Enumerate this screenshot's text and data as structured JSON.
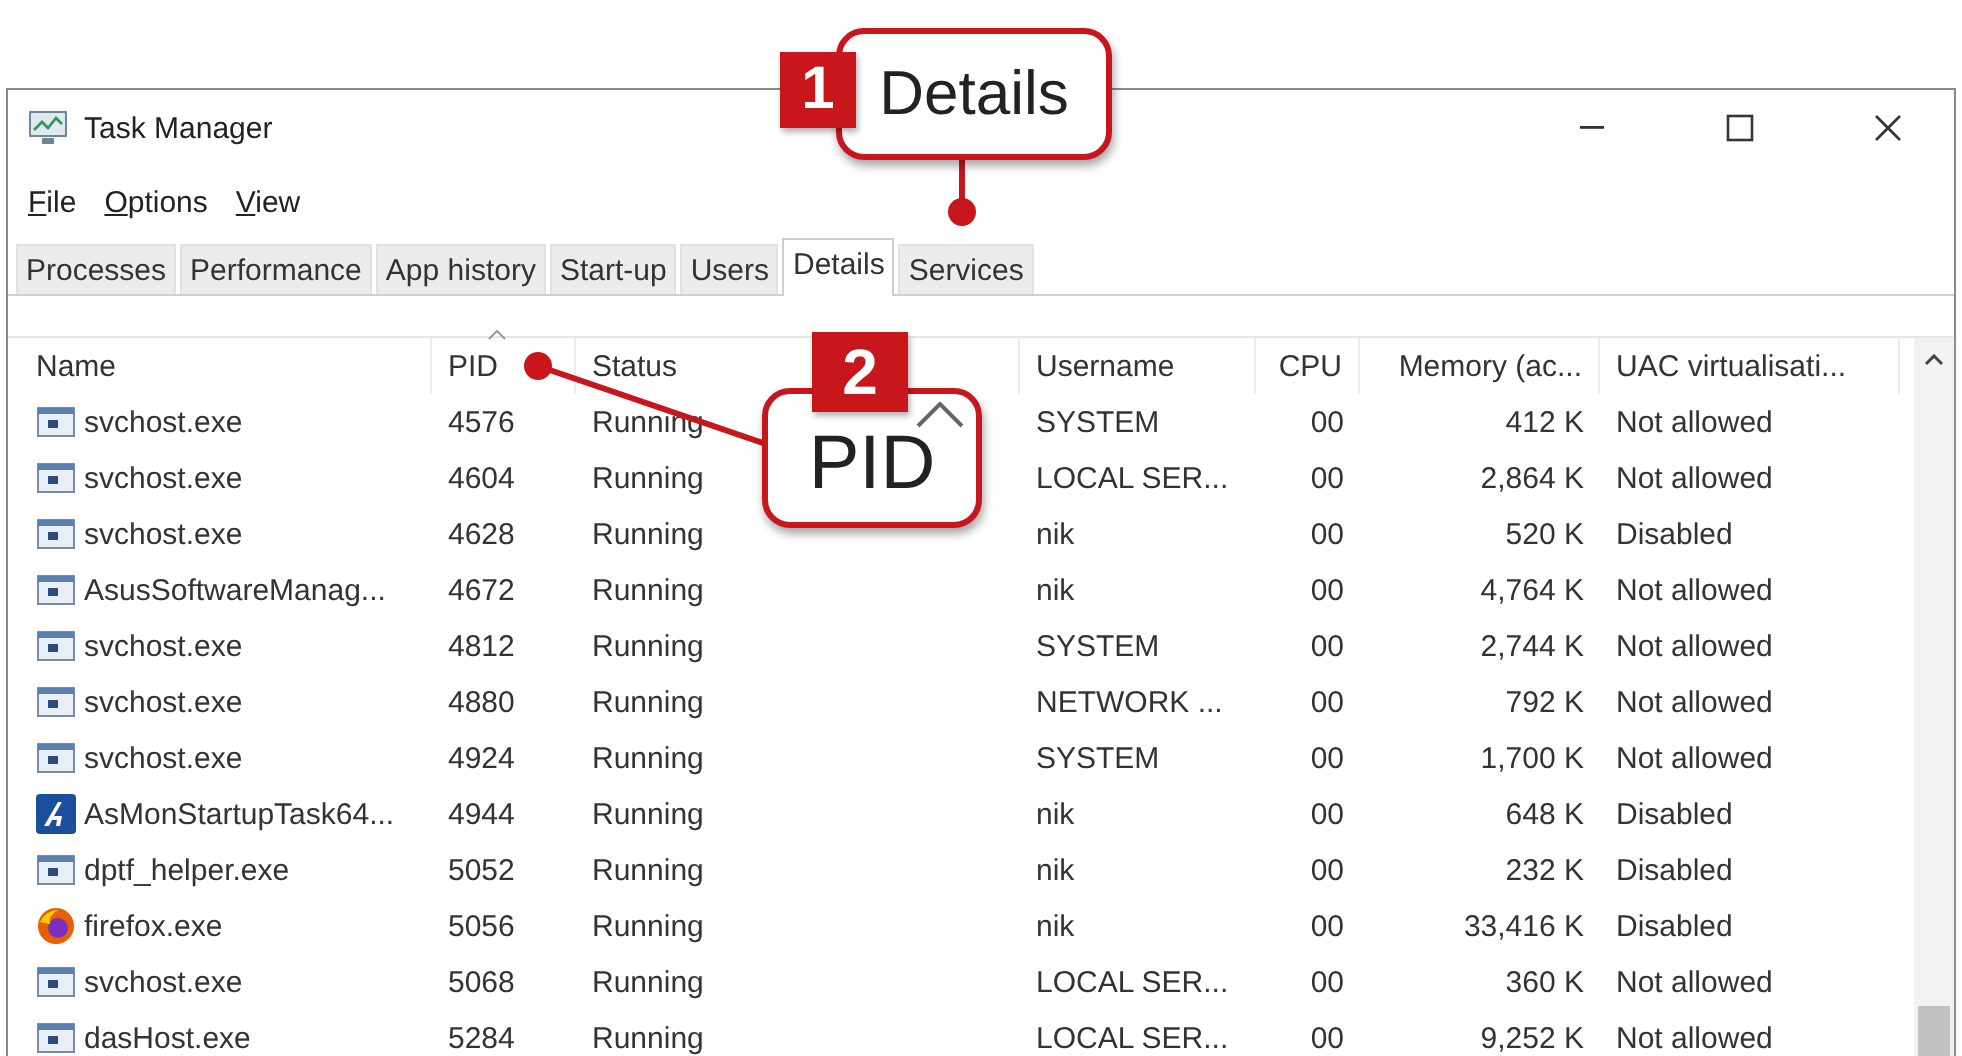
{
  "window": {
    "title": "Task Manager"
  },
  "menu": [
    "File",
    "Options",
    "View"
  ],
  "tabs": [
    {
      "label": "Processes",
      "selected": false
    },
    {
      "label": "Performance",
      "selected": false
    },
    {
      "label": "App history",
      "selected": false
    },
    {
      "label": "Start-up",
      "selected": false
    },
    {
      "label": "Users",
      "selected": false
    },
    {
      "label": "Details",
      "selected": true
    },
    {
      "label": "Services",
      "selected": false
    }
  ],
  "table": {
    "columns": [
      {
        "label": "Name",
        "sorted": false
      },
      {
        "label": "PID",
        "sorted": true
      },
      {
        "label": "Status",
        "sorted": false
      },
      {
        "label": "Username",
        "sorted": false
      },
      {
        "label": "CPU",
        "sorted": false
      },
      {
        "label": "Memory (ac...",
        "sorted": false
      },
      {
        "label": "UAC virtualisati...",
        "sorted": false
      }
    ],
    "rows": [
      {
        "kind": "generic",
        "cells": [
          "svchost.exe",
          "4576",
          "Running",
          "SYSTEM",
          "00",
          "412 K",
          "Not allowed"
        ]
      },
      {
        "kind": "generic",
        "cells": [
          "svchost.exe",
          "4604",
          "Running",
          "LOCAL SER...",
          "00",
          "2,864 K",
          "Not allowed"
        ]
      },
      {
        "kind": "generic",
        "cells": [
          "svchost.exe",
          "4628",
          "Running",
          "nik",
          "00",
          "520 K",
          "Disabled"
        ]
      },
      {
        "kind": "generic",
        "cells": [
          "AsusSoftwareManag...",
          "4672",
          "Running",
          "nik",
          "00",
          "4,764 K",
          "Not allowed"
        ]
      },
      {
        "kind": "generic",
        "cells": [
          "svchost.exe",
          "4812",
          "Running",
          "SYSTEM",
          "00",
          "2,744 K",
          "Not allowed"
        ]
      },
      {
        "kind": "generic",
        "cells": [
          "svchost.exe",
          "4880",
          "Running",
          "NETWORK ...",
          "00",
          "792 K",
          "Not allowed"
        ]
      },
      {
        "kind": "generic",
        "cells": [
          "svchost.exe",
          "4924",
          "Running",
          "SYSTEM",
          "00",
          "1,700 K",
          "Not allowed"
        ]
      },
      {
        "kind": "startup",
        "cells": [
          "AsMonStartupTask64...",
          "4944",
          "Running",
          "nik",
          "00",
          "648 K",
          "Disabled"
        ]
      },
      {
        "kind": "generic",
        "cells": [
          "dptf_helper.exe",
          "5052",
          "Running",
          "nik",
          "00",
          "232 K",
          "Disabled"
        ]
      },
      {
        "kind": "browser",
        "cells": [
          "firefox.exe",
          "5056",
          "Running",
          "nik",
          "00",
          "33,416 K",
          "Disabled"
        ]
      },
      {
        "kind": "generic",
        "cells": [
          "svchost.exe",
          "5068",
          "Running",
          "LOCAL SER...",
          "00",
          "360 K",
          "Not allowed"
        ]
      },
      {
        "kind": "generic",
        "cells": [
          "dasHost.exe",
          "5284",
          "Running",
          "LOCAL SER...",
          "00",
          "9,252 K",
          "Not allowed"
        ]
      }
    ]
  },
  "callouts": [
    {
      "number": "1",
      "label": "Details"
    },
    {
      "number": "2",
      "label": "PID"
    }
  ]
}
